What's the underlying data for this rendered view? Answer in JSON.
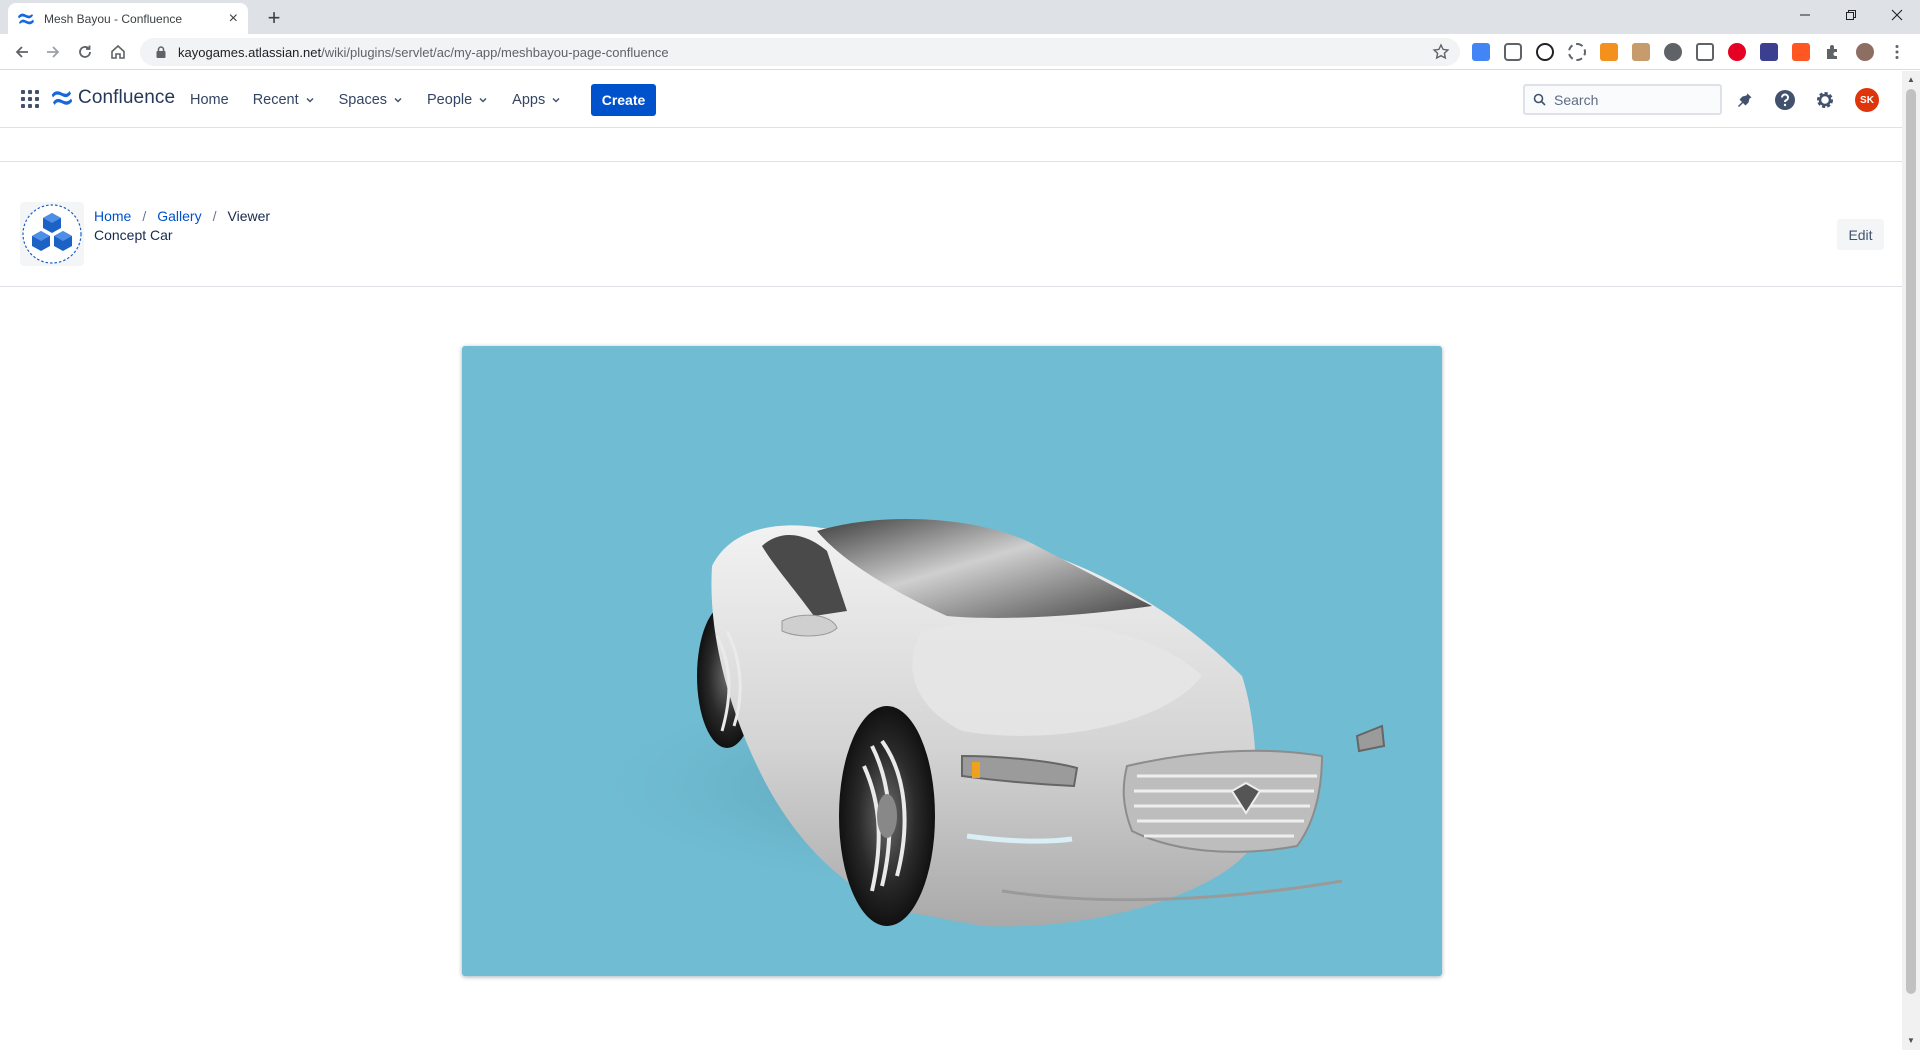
{
  "browser": {
    "tab_title": "Mesh Bayou - Confluence",
    "tab_close": "×",
    "new_tab": "+",
    "url_host": "kayogames.atlassian.net",
    "url_path": "/wiki/plugins/servlet/ac/my-app/meshbayou-page-confluence"
  },
  "header": {
    "brand": "Confluence",
    "nav": [
      {
        "label": "Home"
      },
      {
        "label": "Recent"
      },
      {
        "label": "Spaces"
      },
      {
        "label": "People"
      },
      {
        "label": "Apps"
      }
    ],
    "create_label": "Create",
    "search_placeholder": "Search",
    "avatar_initials": "SK"
  },
  "page": {
    "breadcrumb": [
      "Home",
      "Gallery",
      "Viewer"
    ],
    "breadcrumb_sep": "/",
    "title": "Concept Car",
    "edit_label": "Edit"
  },
  "viewer": {
    "background": "#70bcd2",
    "model_color": "#d9d9d9"
  },
  "colors": {
    "brand_blue": "#0052cc",
    "text_primary": "#172b4d",
    "avatar_red": "#de350b"
  }
}
